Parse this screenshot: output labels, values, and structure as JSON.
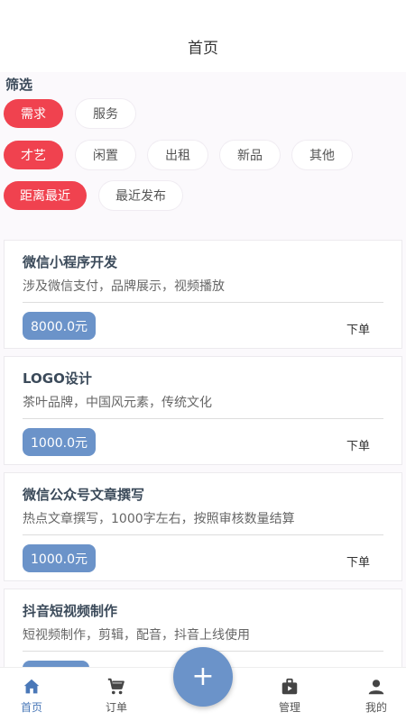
{
  "header": {
    "title": "首页"
  },
  "filter": {
    "label": "筛选",
    "row1": [
      "需求",
      "服务"
    ],
    "row2": [
      "才艺",
      "闲置",
      "出租",
      "新品",
      "其他"
    ],
    "row3": [
      "距离最近",
      "最近发布"
    ]
  },
  "cards": [
    {
      "title": "微信小程序开发",
      "desc": "涉及微信支付，品牌展示，视频播放",
      "price": "8000.0元",
      "action": "下单"
    },
    {
      "title": "LOGO设计",
      "desc": "茶叶品牌，中国风元素，传统文化",
      "price": "1000.0元",
      "action": "下单"
    },
    {
      "title": "微信公众号文章撰写",
      "desc": "热点文章撰写，1000字左右，按照审核数量结算",
      "price": "1000.0元",
      "action": "下单"
    },
    {
      "title": "抖音短视频制作",
      "desc": "短视频制作，剪辑，配音，抖音上线使用",
      "price": "",
      "action": ""
    }
  ],
  "tabbar": {
    "home": "首页",
    "orders": "订单",
    "add": "+",
    "manage": "管理",
    "mine": "我的"
  },
  "colors": {
    "accent_red": "#f0424f",
    "accent_blue": "#6b93c9",
    "tab_active": "#4a78b8"
  },
  "icons": {
    "home": "home-icon",
    "orders": "cart-icon",
    "add": "plus-icon",
    "manage": "briefcase-icon",
    "mine": "person-icon"
  }
}
